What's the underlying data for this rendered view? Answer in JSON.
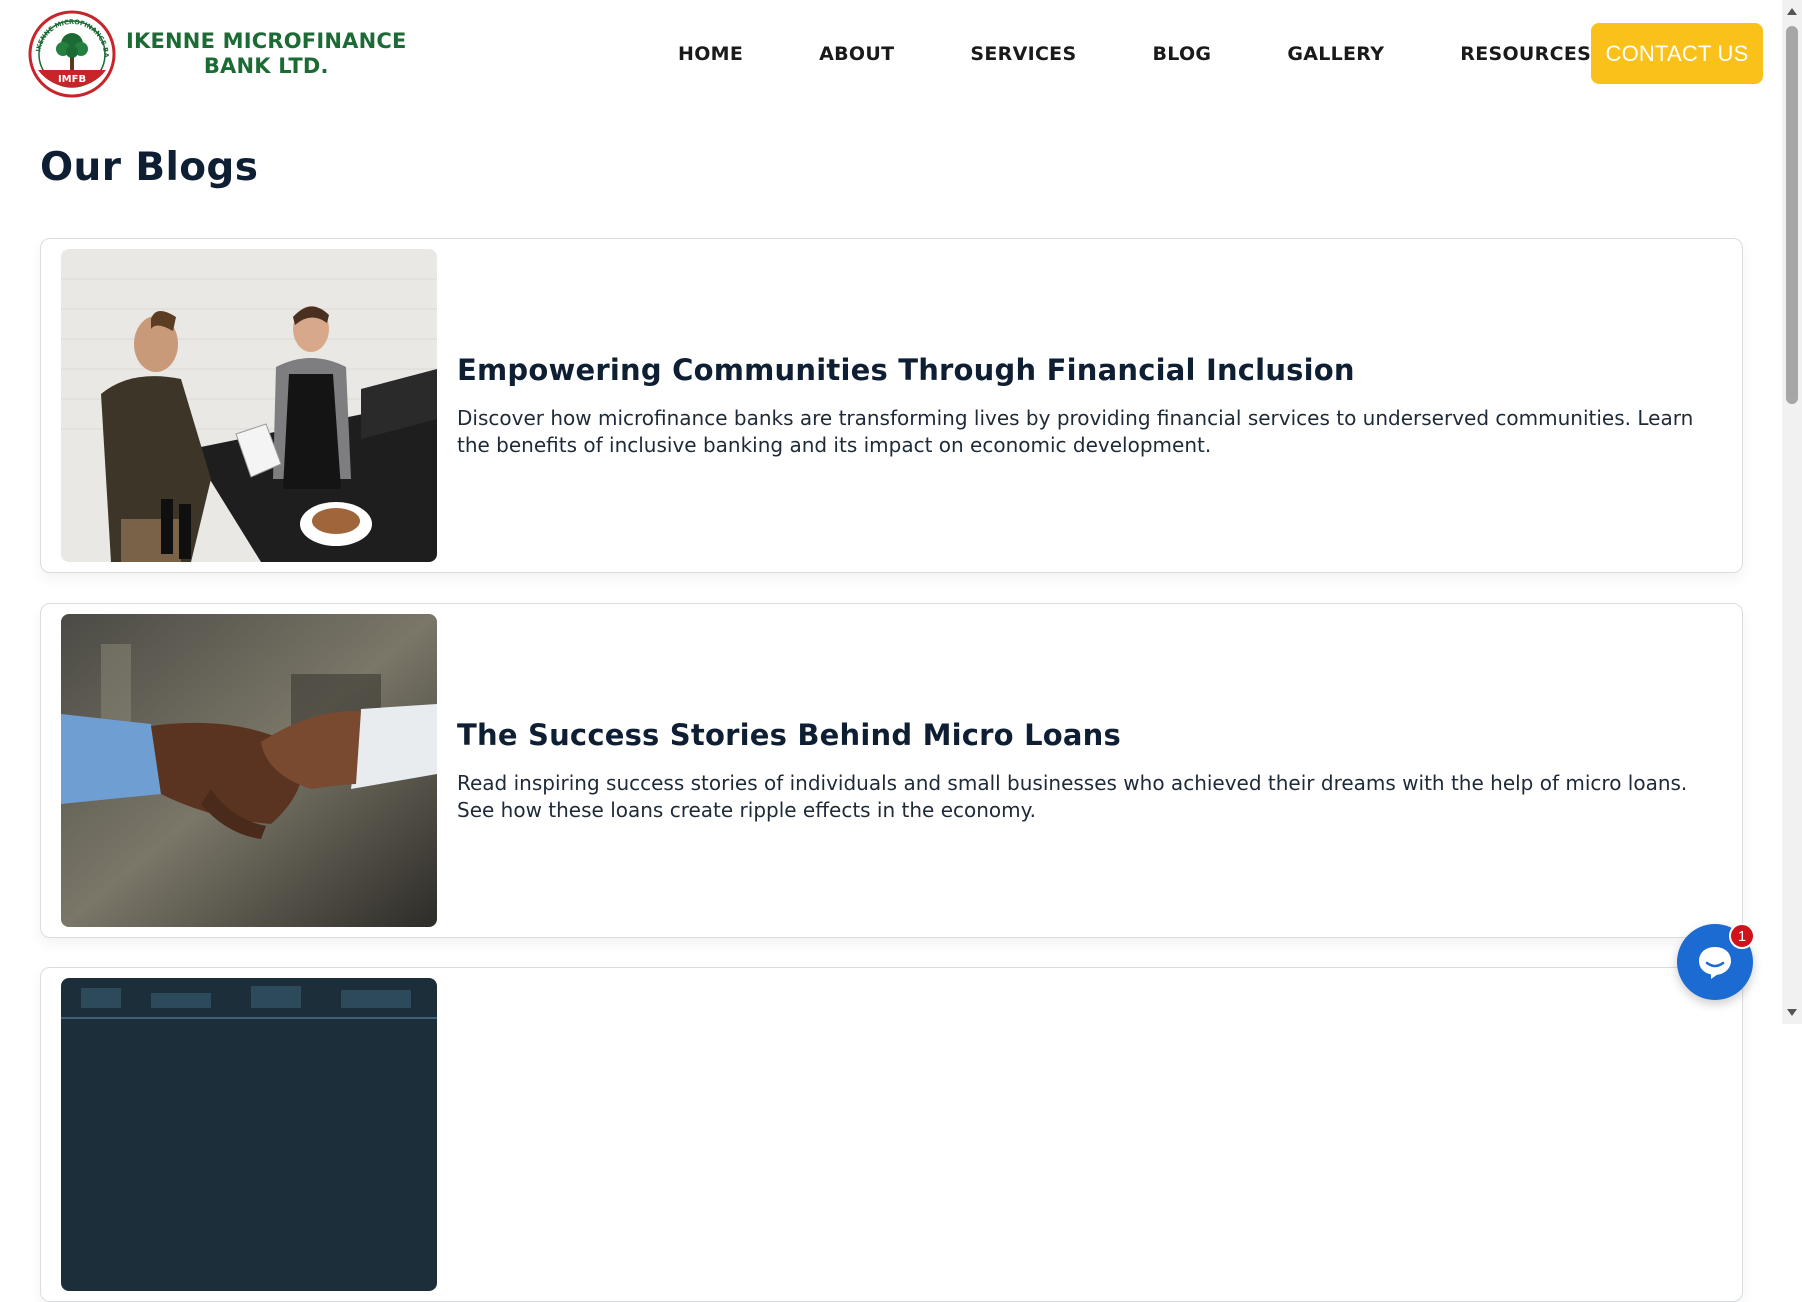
{
  "brand": {
    "name_line1": "IKENNE MICROFINANCE",
    "name_line2": "BANK LTD.",
    "seal_ring_text": "IKENNE MICROFINANCE BANK LTD",
    "seal_badge": "IMFB",
    "colors": {
      "green": "#1c6b35",
      "red": "#c8252b"
    }
  },
  "nav": {
    "items": [
      {
        "label": "HOME"
      },
      {
        "label": "ABOUT"
      },
      {
        "label": "SERVICES"
      },
      {
        "label": "BLOG"
      },
      {
        "label": "GALLERY"
      },
      {
        "label": "RESOURCES"
      }
    ],
    "contact_label": "CONTACT US",
    "contact_color": "#fbc11b"
  },
  "page": {
    "title": "Our Blogs"
  },
  "posts": [
    {
      "title": "Empowering Communities Through Financial Inclusion",
      "excerpt": "Discover how microfinance banks are transforming lives by providing financial services to underserved communities. Learn the benefits of inclusive banking and its impact on economic development.",
      "image": "photo-cafe-payment"
    },
    {
      "title": "The Success Stories Behind Micro Loans",
      "excerpt": "Read inspiring success stories of individuals and small businesses who achieved their dreams with the help of micro loans. See how these loans create ripple effects in the economy.",
      "image": "photo-handshake"
    },
    {
      "title": "",
      "excerpt": "",
      "image": "photo-circuit-board"
    }
  ],
  "chat": {
    "icon": "chat-bubble-icon",
    "badge_count": "1",
    "color": "#1b6bd3"
  }
}
